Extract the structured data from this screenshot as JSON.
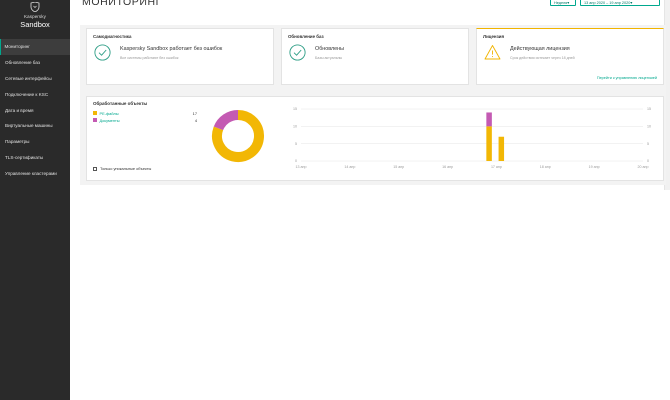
{
  "app": {
    "brand": "Kaspersky",
    "product": "Sandbox"
  },
  "sidebar": {
    "items": [
      {
        "label": "Мониторинг",
        "active": true
      },
      {
        "label": "Обновление баз"
      },
      {
        "label": "Сетевые интерфейсы"
      },
      {
        "label": "Подключение к KSC"
      },
      {
        "label": "Дата и время"
      },
      {
        "label": "Виртуальные машины"
      },
      {
        "label": "Параметры"
      },
      {
        "label": "TLS-сертификаты"
      },
      {
        "label": "Управление кластерами"
      }
    ]
  },
  "header": {
    "title": "Мониторинг",
    "period_button": "Неделя",
    "date_button": "13 апр 2020 – 19 апр 2020"
  },
  "cards": {
    "selfcheck": {
      "title": "Самодиагностика",
      "status": "Kaspersky Sandbox работает без ошибок",
      "detail": "Все системы работают без ошибок"
    },
    "updates": {
      "title": "Обновление баз",
      "status": "Обновлены",
      "detail": "Базы актуальны"
    },
    "license": {
      "title": "Лицензия",
      "status": "Действующая лицензия",
      "detail": "Срок действия истекает через 18 дней",
      "link": "Перейти к управлению лицензией"
    }
  },
  "objects": {
    "title": "Обработанные объекты",
    "legend": [
      {
        "label": "PE-файлы",
        "count": "17",
        "color": "#f2b705"
      },
      {
        "label": "Документы",
        "count": "4",
        "color": "#c45ab3"
      }
    ],
    "unique_only_label": "Только уникальные объекты",
    "unique_only_checked": false
  },
  "colors": {
    "accent": "#00a88e",
    "warning": "#f1b400",
    "pe_files": "#f2b705",
    "documents": "#c45ab3"
  },
  "icons": {
    "selfcheck": "check-circle-icon",
    "updates": "check-circle-icon",
    "license": "warning-triangle-icon"
  },
  "chart_data": [
    {
      "type": "pie",
      "categories": [
        "PE-файлы",
        "Документы"
      ],
      "values": [
        17,
        4
      ]
    },
    {
      "type": "bar",
      "stacked": true,
      "categories": [
        "13 апр",
        "14 апр",
        "15 апр",
        "16 апр",
        "17 апр",
        "18 апр",
        "19 апр",
        "20 апр"
      ],
      "x_period_labels": [
        "",
        "",
        "",
        "",
        "",
        "",
        "",
        ""
      ],
      "series": [
        {
          "name": "PE-файлы",
          "color": "#f2b705",
          "points": [
            {
              "x": 16.85,
              "y": 10
            },
            {
              "x": 17.1,
              "y": 7
            }
          ]
        },
        {
          "name": "Документы",
          "color": "#c45ab3",
          "points": [
            {
              "x": 16.85,
              "y": 4
            },
            {
              "x": 17.1,
              "y": 0
            }
          ]
        }
      ],
      "y_ticks": [
        "0",
        "5",
        "10",
        "15"
      ],
      "ylim": [
        0,
        15
      ],
      "grid": true
    }
  ]
}
